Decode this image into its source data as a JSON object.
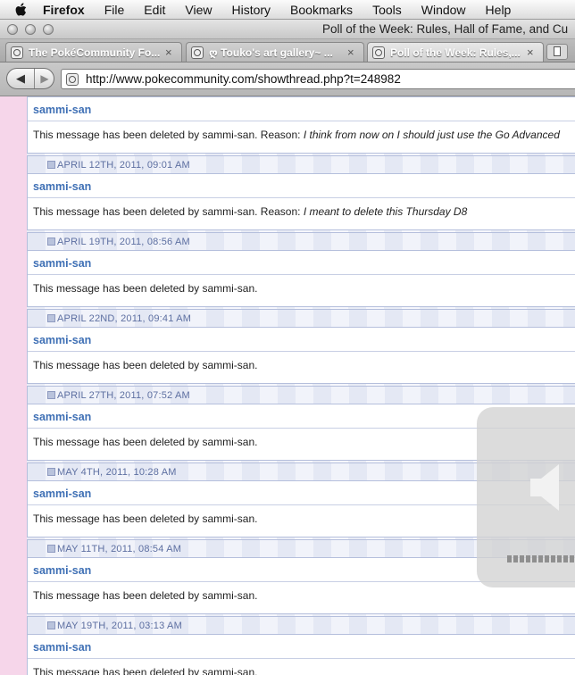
{
  "menubar": {
    "app": "Firefox",
    "items": [
      "File",
      "Edit",
      "View",
      "History",
      "Bookmarks",
      "Tools",
      "Window",
      "Help"
    ]
  },
  "window": {
    "title": "Poll of the Week: Rules, Hall of Fame, and Cu"
  },
  "tabs": [
    {
      "label": "The PokéCommunity Fo...",
      "close": "×"
    },
    {
      "label": "ღ Touko's art gallery~ ...",
      "close": "×"
    },
    {
      "label": "Poll of the Week: Rules,...",
      "close": "×"
    }
  ],
  "navigation": {
    "back": "◀",
    "forward": "▶",
    "url": "http://www.pokecommunity.com/showthread.php?t=248982"
  },
  "posts": [
    {
      "author": "sammi-san",
      "message": "This message has been deleted by sammi-san. Reason: ",
      "reason": "I think from now on I should just use the Go Advanced"
    },
    {
      "date": "APRIL 12TH, 2011, 09:01 AM",
      "author": "sammi-san",
      "message": "This message has been deleted by sammi-san. Reason: ",
      "reason": "I meant to delete this Thursday D8"
    },
    {
      "date": "APRIL 19TH, 2011, 08:56 AM",
      "author": "sammi-san",
      "message": "This message has been deleted by sammi-san."
    },
    {
      "date": "APRIL 22ND, 2011, 09:41 AM",
      "author": "sammi-san",
      "message": "This message has been deleted by sammi-san."
    },
    {
      "date": "APRIL 27TH, 2011, 07:52 AM",
      "author": "sammi-san",
      "message": "This message has been deleted by sammi-san."
    },
    {
      "date": "MAY 4TH, 2011, 10:28 AM",
      "author": "sammi-san",
      "message": "This message has been deleted by sammi-san."
    },
    {
      "date": "MAY 11TH, 2011, 08:54 AM",
      "author": "sammi-san",
      "message": "This message has been deleted by sammi-san."
    },
    {
      "date": "MAY 19TH, 2011, 03:13 AM",
      "author": "sammi-san",
      "message": "This message has been deleted by sammi-san."
    }
  ],
  "volume_hud": {
    "icon": "speaker-icon",
    "level": 0
  }
}
